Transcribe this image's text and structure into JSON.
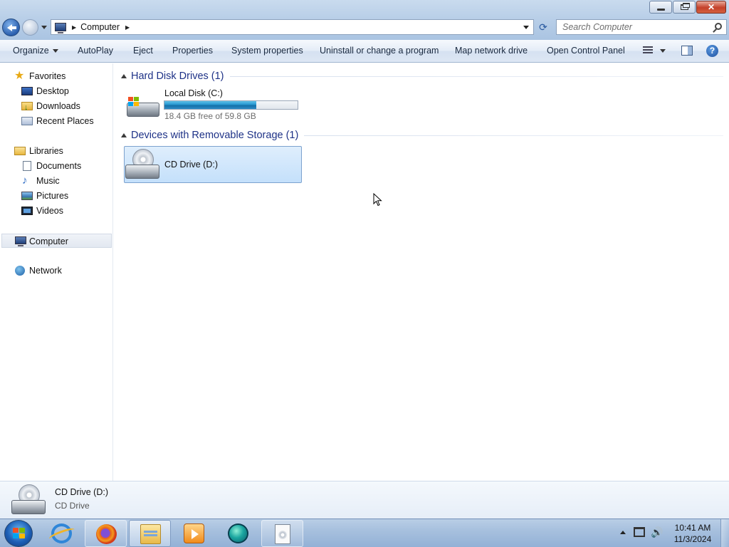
{
  "window": {
    "address_crumb": "Computer",
    "search_placeholder": "Search Computer"
  },
  "commands": {
    "organize": "Organize",
    "autoplay": "AutoPlay",
    "eject": "Eject",
    "properties": "Properties",
    "system_properties": "System properties",
    "uninstall": "Uninstall or change a program",
    "map_network_drive": "Map network drive",
    "open_control_panel": "Open Control Panel"
  },
  "nav": {
    "favorites": "Favorites",
    "desktop": "Desktop",
    "downloads": "Downloads",
    "recent_places": "Recent Places",
    "libraries": "Libraries",
    "documents": "Documents",
    "music": "Music",
    "pictures": "Pictures",
    "videos": "Videos",
    "computer": "Computer",
    "network": "Network"
  },
  "groups": {
    "hard_disk": "Hard Disk Drives (1)",
    "removable": "Devices with Removable Storage (1)"
  },
  "drives": {
    "local_disk": {
      "name": "Local Disk (C:)",
      "free_text": "18.4 GB free of 59.8 GB",
      "used_fraction": 0.69
    },
    "cd_drive": {
      "name": "CD Drive (D:)"
    }
  },
  "details": {
    "name": "CD Drive (D:)",
    "type": "CD Drive"
  },
  "taskbar": {
    "time": "10:41 AM",
    "date": "11/3/2024"
  },
  "colors": {
    "group_header": "#1e3287",
    "selection": "#c4e0fb",
    "capacity_bar": "#2695cf"
  }
}
